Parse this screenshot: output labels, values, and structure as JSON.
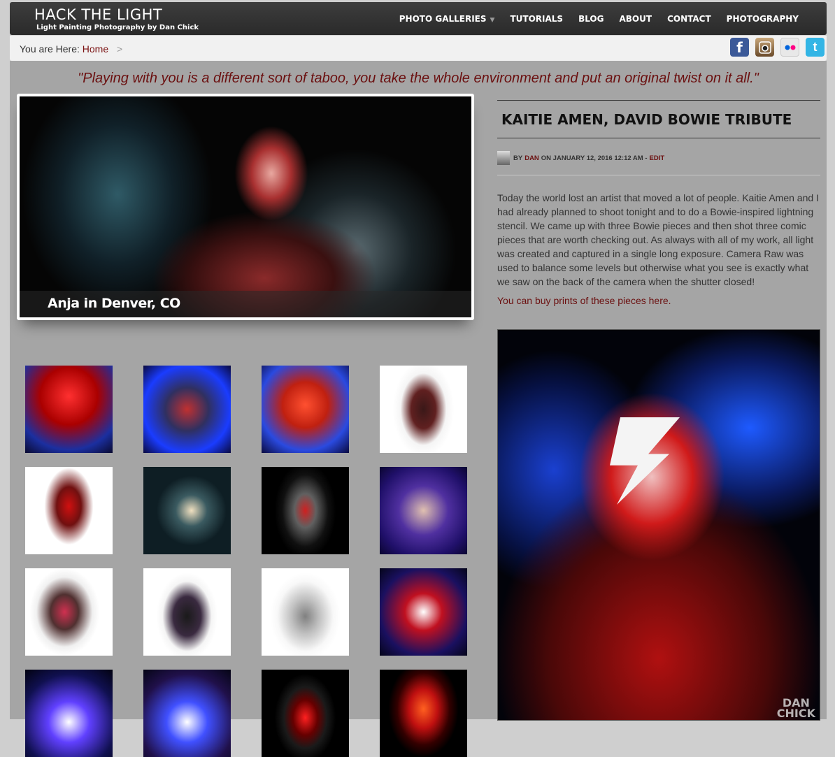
{
  "site": {
    "title": "HACK THE LIGHT",
    "subtitle": "Light Painting Photography by Dan Chick"
  },
  "nav": {
    "items": [
      {
        "label": "PHOTO GALLERIES",
        "dropdown": true
      },
      {
        "label": "TUTORIALS"
      },
      {
        "label": "BLOG"
      },
      {
        "label": "ABOUT"
      },
      {
        "label": "CONTACT"
      },
      {
        "label": "PHOTOGRAPHY"
      }
    ]
  },
  "breadcrumb": {
    "prefix": "You are Here:",
    "home": "Home",
    "separator": ">"
  },
  "social": [
    {
      "name": "facebook-icon",
      "glyph": "f"
    },
    {
      "name": "instagram-icon",
      "glyph": ""
    },
    {
      "name": "flickr-icon",
      "glyph": ""
    },
    {
      "name": "twitter-icon",
      "glyph": "t"
    }
  ],
  "quote": "\"Playing with you is a different sort of taboo, you take the whole environment and put an original twist on it all.\"",
  "slider": {
    "caption": "Anja in Denver, CO"
  },
  "thumbnails": [
    {
      "bg": "radial-gradient(circle at 50% 35%, #ff3030 0%, #a00 40%, #1b2fa0 75%, #0a0a30 100%)"
    },
    {
      "bg": "radial-gradient(circle at 50% 50%, #c03030 0%, #303060 35%, #1a3cff 70%, #0a0a40 100%)"
    },
    {
      "bg": "radial-gradient(circle at 50% 45%, #ff5030 0%, #c02010 35%, #2a4ae0 70%, #0a0a40 100%)"
    },
    {
      "bg": "radial-gradient(ellipse 35% 55% at 50% 50%, #3a1818 0%, #602020 40%, #f5f5f5 75%, #ffffff 100%)"
    },
    {
      "bg": "radial-gradient(ellipse 35% 55% at 50% 45%, #d01010 0%, #701010 40%, #ffffff 80%)"
    },
    {
      "bg": "radial-gradient(ellipse 40% 40% at 55% 50%, #f0e0c0 0%, #3a5a60 45%, #0e1e24 100%)"
    },
    {
      "bg": "radial-gradient(ellipse 35% 55% at 50% 50%, #d02020 0%, #606060 35%, #101010 75%, #000 100%)"
    },
    {
      "bg": "radial-gradient(circle at 50% 50%, #e0c0b0 0%, #5030a0 40%, #20106a 75%, #0a0530 100%)"
    },
    {
      "bg": "radial-gradient(ellipse 40% 50% at 45% 50%, #d03050 0%, #503030 40%, #f0f0f0 80%, #fff 100%)"
    },
    {
      "bg": "radial-gradient(ellipse 35% 50% at 50% 55%, #1a1a1a 0%, #3a2a40 45%, #f5f5f5 80%, #fff 100%)"
    },
    {
      "bg": "radial-gradient(ellipse 40% 50% at 50% 55%, #808080 0%, #c0c0c0 40%, #f8f8f8 80%, #fff 100%)"
    },
    {
      "bg": "radial-gradient(circle at 50% 50%, #ffffff 0%, #c01020 30%, #1a1060 70%, #05051a 100%)"
    },
    {
      "bg": "radial-gradient(circle at 50% 60%, #ffffff 0%, #6040ff 30%, #101050 70%, #020210 100%)"
    },
    {
      "bg": "radial-gradient(circle at 50% 60%, #ffffff 0%, #4050ff 30%, #20104a 70%, #050515 100%)"
    },
    {
      "bg": "radial-gradient(ellipse 35% 50% at 50% 55%, #ff2020 0%, #600 40%, #1a1a1a 70%, #000 100%)"
    },
    {
      "bg": "radial-gradient(ellipse 40% 55% at 50% 45%, #ff6020 0%, #c01010 40%, #300 75%, #000 100%)"
    }
  ],
  "post": {
    "title": "KAITIE AMEN, DAVID BOWIE TRIBUTE",
    "by": "BY",
    "author": "DAN",
    "date": "ON JANUARY 12, 2016 12:12 AM -",
    "edit": "EDIT",
    "body": "Today the world lost an artist that moved a lot of people.  Kaitie Amen and I had already planned to shoot tonight and to do a Bowie-inspired lightning stencil.  We came up with three Bowie pieces and then shot three comic pieces that are worth checking out.  As always with all of my work, all light was created and captured in a single long exposure.   Camera Raw was used to balance some levels but otherwise what you see is exactly what we saw on the back of the camera when the shutter closed!",
    "buy_link": "You can buy prints of these pieces here.",
    "watermark_line1": "DAN",
    "watermark_line2": "CHICK"
  }
}
